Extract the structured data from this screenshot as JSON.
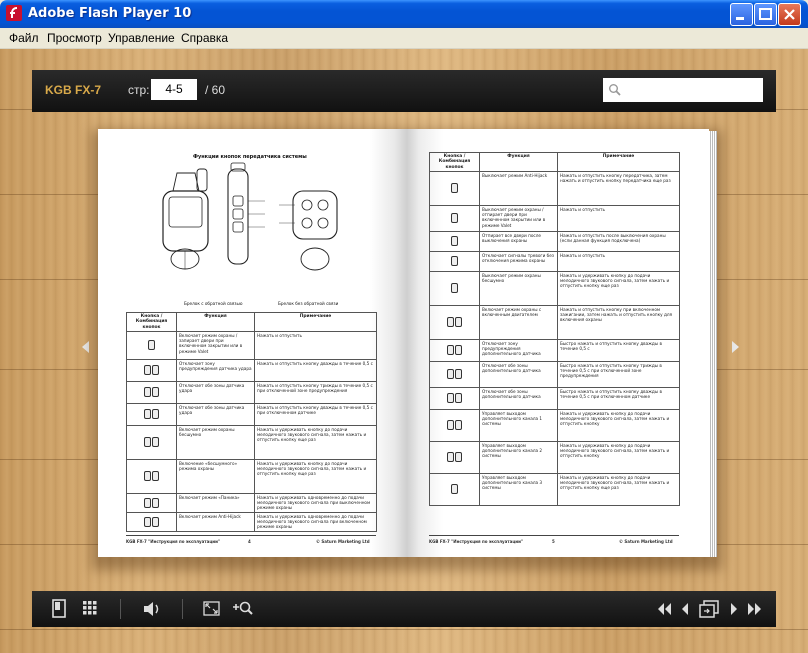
{
  "window": {
    "title": "Adobe Flash Player 10"
  },
  "menu": {
    "items": [
      "Файл",
      "Просмотр",
      "Управление",
      "Справка"
    ]
  },
  "toolbar": {
    "brand": "KGB FX-7",
    "page_label": "стр:",
    "page_value": "4-5",
    "page_total": "/ 60",
    "search_value": ""
  },
  "left_page": {
    "title": "Функции кнопок передатчика системы",
    "caption_left": "Брелок с обратной связью",
    "caption_right": "Брелок без обратной связи",
    "headers": [
      "Кнопка / Комбинация кнопок",
      "Функция",
      "Примечание"
    ],
    "rows": [
      {
        "fn": "Включает режим охраны / запирает двери при включенном закрытии или в режиме Valet",
        "note": "Нажать и отпустить"
      },
      {
        "fn": "Отключает зону предупреждения датчика удара",
        "note": "Нажать и отпустить кнопку дважды в течение 0,5 с"
      },
      {
        "fn": "Отключает обе зоны датчика удара",
        "note": "Нажать и отпустить кнопку трижды в течение 0,5 с при отключенной зоне предупреждения"
      },
      {
        "fn": "Отключает обе зоны датчика удара",
        "note": "Нажать и отпустить кнопку дважды в течение 0,5 с при отключенном датчике"
      },
      {
        "fn": "Включает режим охраны бесшумно",
        "note": "Нажать и удерживать кнопку до подачи мелодичного звукового сигнала, затем нажать и отпустить кнопку еще раз"
      },
      {
        "fn": "Включение «бесшумного» режима охраны",
        "note": "Нажать и удерживать кнопку до подачи мелодичного звукового сигнала, затем нажать и отпустить кнопку еще раз"
      },
      {
        "fn": "Включает режим «Паника»",
        "note": "Нажать и удерживать одновременно до подачи мелодичного звукового сигнала при выключенном режиме охраны"
      },
      {
        "fn": "Включает режим Anti-Hijack",
        "note": "Нажать и удерживать одновременно до подачи мелодичного звукового сигнала при включенном режиме охраны"
      }
    ],
    "footer_left": "KGB FX-7 \"Инструкция по эксплуатации\"",
    "footer_page": "4",
    "footer_right": "© Saturn Marketing Ltd"
  },
  "right_page": {
    "headers": [
      "Кнопка / Комбинация кнопок",
      "Функция",
      "Примечание"
    ],
    "rows": [
      {
        "fn": "Выключает режим Anti-Hijack",
        "note": "Нажать и отпустить кнопку передатчика, затем нажать и отпустить кнопку передатчика еще раз"
      },
      {
        "fn": "Выключает режим охраны / отпирает двери при включенном закрытии или в режиме Valet",
        "note": "Нажать и отпустить"
      },
      {
        "fn": "Отпирает все двери после выключения охраны",
        "note": "Нажать и отпустить после выключения охраны (если данная функция подключена)"
      },
      {
        "fn": "Отключает сигналы тревоги без отключения режима охраны",
        "note": "Нажать и отпустить"
      },
      {
        "fn": "Выключает режим охраны бесшумно",
        "note": "Нажать и удерживать кнопку до подачи мелодичного звукового сигнала, затем нажать и отпустить кнопку еще раз"
      },
      {
        "fn": "Включает режим охраны с включенным двигателем",
        "note": "Нажать и отпустить кнопку при включенном зажигании, затем нажать и отпустить кнопку для включения охраны"
      },
      {
        "fn": "Отключает зону предупреждения дополнительного датчика",
        "note": "Быстро нажать и отпустить кнопку дважды в течение 0,5 с"
      },
      {
        "fn": "Отключает обе зоны дополнительного датчика",
        "note": "Быстро нажать и отпустить кнопку трижды в течение 0,5 с при отключенной зоне предупреждения"
      },
      {
        "fn": "Отключает обе зоны дополнительного датчика",
        "note": "Быстро нажать и отпустить кнопку дважды в течение 0,5 с при отключенном датчике"
      },
      {
        "fn": "Управляет выходом дополнительного канала 1 системы",
        "note": "Нажать и удерживать кнопку до подачи мелодичного звукового сигнала, затем нажать и отпустить кнопку"
      },
      {
        "fn": "Управляет выходом дополнительного канала 2 системы",
        "note": "Нажать и удерживать кнопку до подачи мелодичного звукового сигнала, затем нажать и отпустить кнопку"
      },
      {
        "fn": "Управляет выходом дополнительного канала 3 системы",
        "note": "Нажать и удерживать кнопку до подачи мелодичного звукового сигнала, затем нажать и отпустить кнопку еще раз"
      }
    ],
    "footer_left": "KGB FX-7 \"Инструкция по эксплуатации\"",
    "footer_page": "5",
    "footer_right": "© Saturn Marketing Ltd"
  },
  "icons": [
    "flash-icon",
    "minimize-icon",
    "maximize-icon",
    "close-icon",
    "search-icon",
    "prev-page-arrow-icon",
    "next-page-arrow-icon",
    "single-page-icon",
    "thumbnails-icon",
    "sound-icon",
    "fullscreen-icon",
    "zoom-in-icon",
    "first-page-icon",
    "previous-page-icon",
    "two-page-view-icon",
    "next-page-icon",
    "last-page-icon"
  ],
  "colors": {
    "titlebar": "#0454d4",
    "toolbar_bg": "#1a1a1a",
    "brand": "#d8a94a"
  }
}
